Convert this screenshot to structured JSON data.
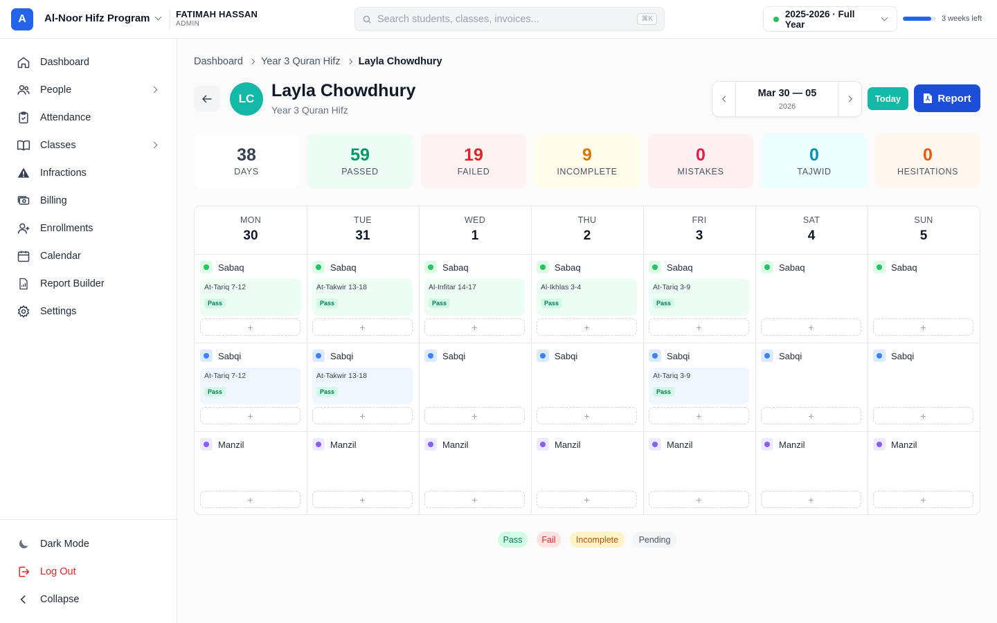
{
  "topbar": {
    "logo_letter": "A",
    "org_name": "Al-Noor Hifz Program",
    "user_name": "FATIMAH HASSAN",
    "user_role": "ADMIN",
    "search_placeholder": "Search students, classes, invoices...",
    "search_shortcut": "⌘K",
    "year_label": "2025-2026 · Full Year",
    "year_progress_percent": 85,
    "weeks_left": "3 weeks left"
  },
  "sidebar": {
    "items": [
      {
        "label": "Dashboard",
        "icon": "home-icon"
      },
      {
        "label": "People",
        "icon": "people-icon",
        "expandable": true
      },
      {
        "label": "Attendance",
        "icon": "clipboard-check-icon"
      },
      {
        "label": "Classes",
        "icon": "book-icon",
        "expandable": true
      },
      {
        "label": "Infractions",
        "icon": "warning-icon"
      },
      {
        "label": "Billing",
        "icon": "banknote-icon"
      },
      {
        "label": "Enrollments",
        "icon": "user-plus-icon"
      },
      {
        "label": "Calendar",
        "icon": "calendar-icon"
      },
      {
        "label": "Report Builder",
        "icon": "report-file-icon"
      },
      {
        "label": "Settings",
        "icon": "gear-icon"
      }
    ],
    "bottom": {
      "dark_mode": "Dark Mode",
      "log_out": "Log Out",
      "collapse": "Collapse"
    }
  },
  "breadcrumb": [
    "Dashboard",
    "Year 3 Quran Hifz",
    "Layla Chowdhury"
  ],
  "student": {
    "initials": "LC",
    "name": "Layla Chowdhury",
    "class": "Year 3 Quran Hifz"
  },
  "date_nav": {
    "range": "Mar 30 — 05",
    "year": "2026"
  },
  "buttons": {
    "today": "Today",
    "report": "Report"
  },
  "stats": [
    {
      "value": "38",
      "label": "DAYS",
      "color": "#374151",
      "bg": "#ffffff"
    },
    {
      "value": "59",
      "label": "PASSED",
      "color": "#059669",
      "bg": "#ecfdf5"
    },
    {
      "value": "19",
      "label": "FAILED",
      "color": "#dc2626",
      "bg": "#fef2f2"
    },
    {
      "value": "9",
      "label": "INCOMPLETE",
      "color": "#d97706",
      "bg": "#fffbeb"
    },
    {
      "value": "0",
      "label": "MISTAKES",
      "color": "#e11d48",
      "bg": "#fff1f2"
    },
    {
      "value": "0",
      "label": "TAJWID",
      "color": "#0891b2",
      "bg": "#ecfeff"
    },
    {
      "value": "0",
      "label": "HESITATIONS",
      "color": "#ea580c",
      "bg": "#fff7ed"
    }
  ],
  "categories": [
    {
      "label": "Sabaq",
      "dot": "#22c55e",
      "icon_bg": "#dcfce7",
      "entry_bg": "#ecfdf3"
    },
    {
      "label": "Sabqi",
      "dot": "#3b82f6",
      "icon_bg": "#dbeafe",
      "entry_bg": "#eff6ff"
    },
    {
      "label": "Manzil",
      "dot": "#8b5cf6",
      "icon_bg": "#ede9fe",
      "entry_bg": "#f5f3ff"
    }
  ],
  "days": [
    {
      "name": "MON",
      "num": "30",
      "entries": {
        "Sabaq": {
          "title": "At-Tariq 7-12",
          "status": "Pass"
        },
        "Sabqi": {
          "title": "At-Tariq 7-12",
          "status": "Pass"
        }
      }
    },
    {
      "name": "TUE",
      "num": "31",
      "entries": {
        "Sabaq": {
          "title": "At-Takwir 13-18",
          "status": "Pass"
        },
        "Sabqi": {
          "title": "At-Takwir 13-18",
          "status": "Pass"
        }
      }
    },
    {
      "name": "WED",
      "num": "1",
      "entries": {
        "Sabaq": {
          "title": "Al-Infitar 14-17",
          "status": "Pass"
        }
      }
    },
    {
      "name": "THU",
      "num": "2",
      "entries": {
        "Sabaq": {
          "title": "Al-Ikhlas 3-4",
          "status": "Pass"
        }
      }
    },
    {
      "name": "FRI",
      "num": "3",
      "entries": {
        "Sabaq": {
          "title": "At-Tariq 3-9",
          "status": "Pass"
        },
        "Sabqi": {
          "title": "At-Tariq 3-9",
          "status": "Pass"
        }
      }
    },
    {
      "name": "SAT",
      "num": "4",
      "entries": {}
    },
    {
      "name": "SUN",
      "num": "5",
      "entries": {}
    }
  ],
  "add_symbol": "+",
  "legend": [
    {
      "label": "Pass",
      "bg": "#d1fae5",
      "color": "#047857"
    },
    {
      "label": "Fail",
      "bg": "#fee2e2",
      "color": "#dc2626"
    },
    {
      "label": "Incomplete",
      "bg": "#fef3c7",
      "color": "#b45309"
    },
    {
      "label": "Pending",
      "bg": "#f3f4f6",
      "color": "#4b5563"
    }
  ]
}
